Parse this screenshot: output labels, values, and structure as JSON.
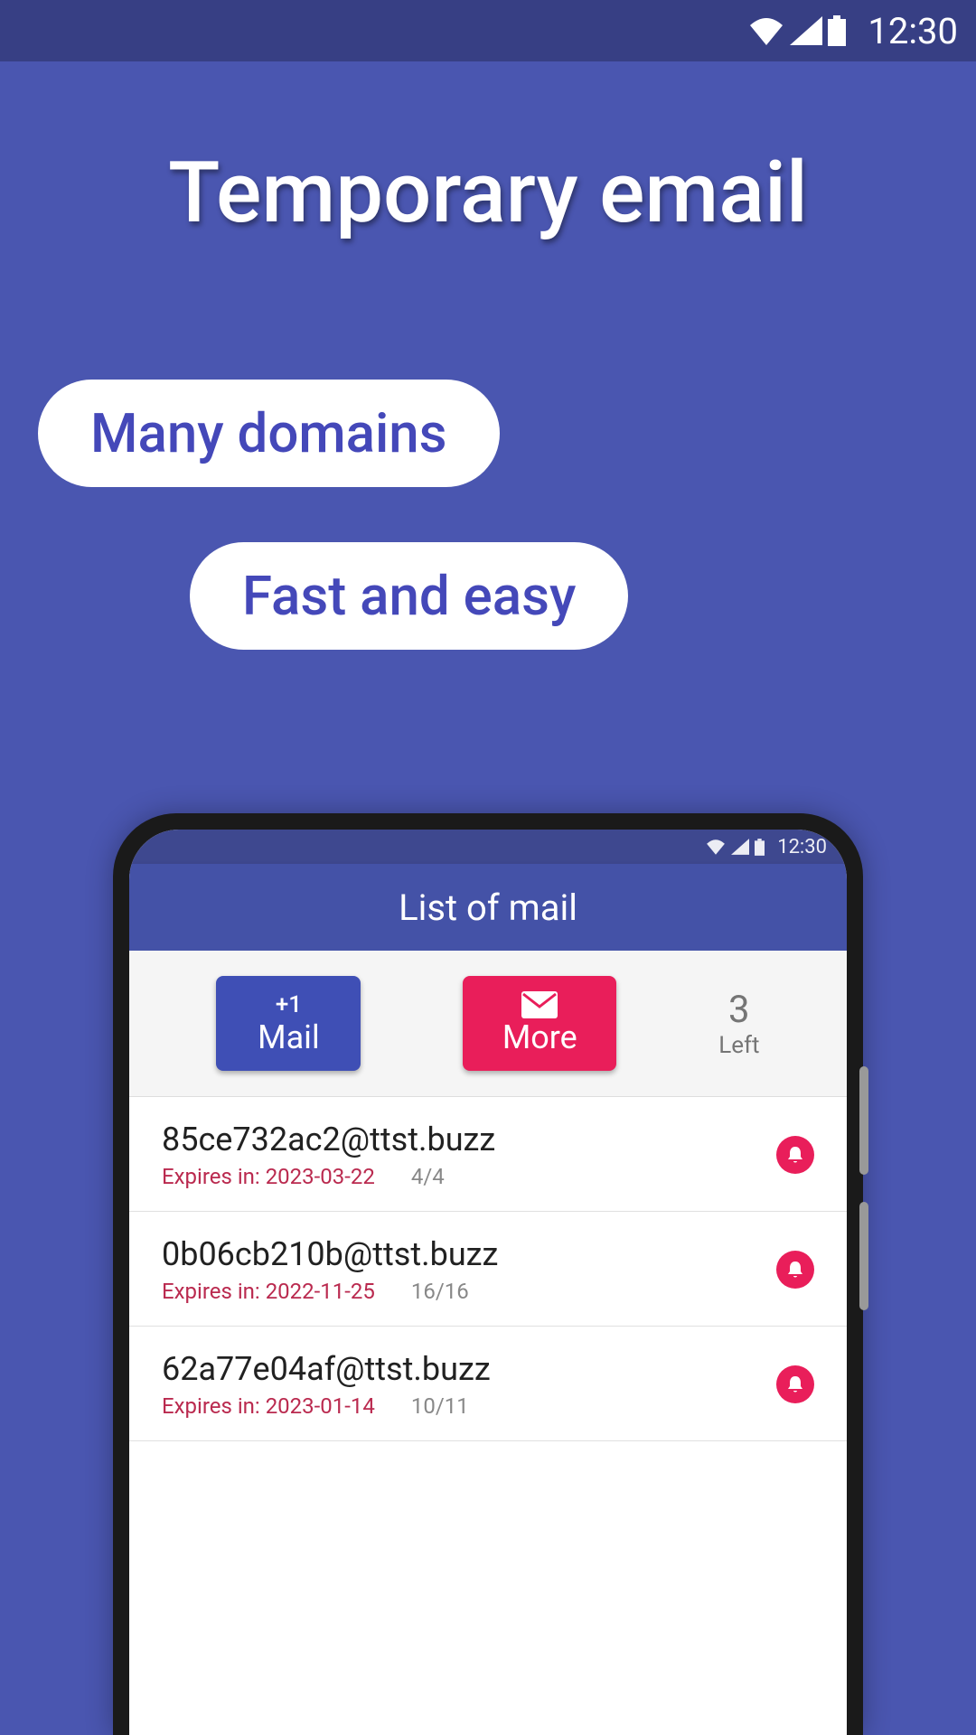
{
  "status_bar": {
    "time": "12:30"
  },
  "hero": {
    "title": "Temporary email",
    "pill1": "Many domains",
    "pill2": "Fast and easy"
  },
  "inner_app": {
    "status_time": "12:30",
    "header_title": "List of mail",
    "mail_button": {
      "plus": "+1",
      "label": "Mail"
    },
    "more_button": {
      "label": "More"
    },
    "left": {
      "count": "3",
      "label": "Left"
    },
    "mails": [
      {
        "address": "85ce732ac2@ttst.buzz",
        "expires": "Expires in: 2023-03-22",
        "count": "4/4"
      },
      {
        "address": "0b06cb210b@ttst.buzz",
        "expires": "Expires in: 2022-11-25",
        "count": "16/16"
      },
      {
        "address": "62a77e04af@ttst.buzz",
        "expires": "Expires in: 2023-01-14",
        "count": "10/11"
      }
    ]
  }
}
